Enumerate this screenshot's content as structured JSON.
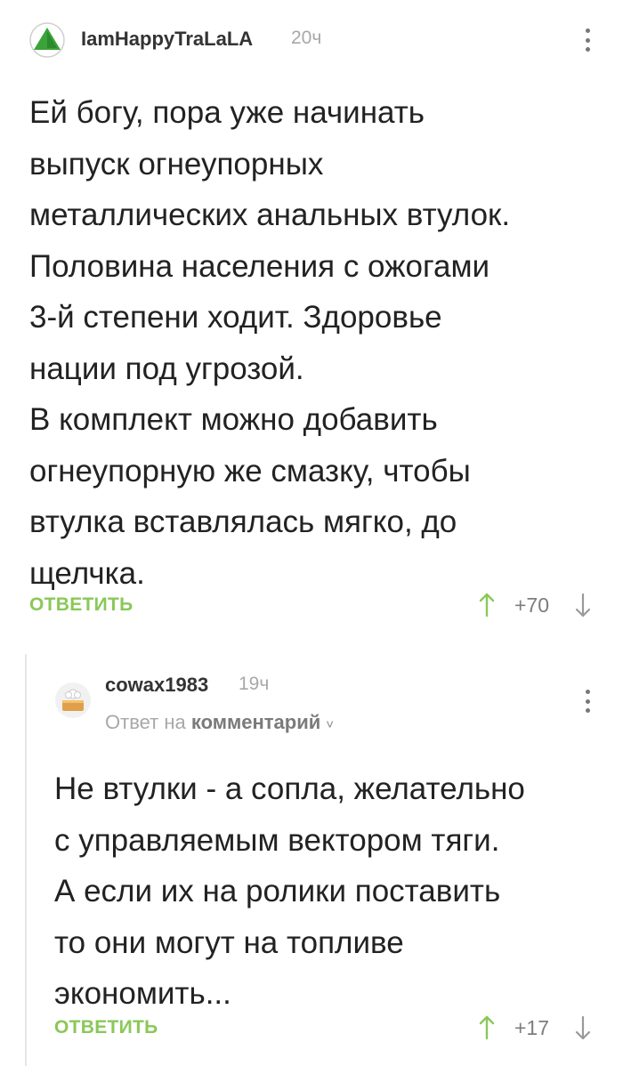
{
  "comments": [
    {
      "author": "IamHappyTraLaLA",
      "time": "20ч",
      "avatar_icon": "green-triangle-avatar-icon",
      "text_lines": [
        "Ей богу, пора уже начинать",
        "выпуск огнеупорных",
        "металлических анальных втулок.",
        "Половина населения с ожогами",
        "3-й степени ходит. Здоровье",
        "нации под угрозой.",
        "В комплект можно добавить",
        "огнеупорную же смазку, чтобы",
        "втулка вставлялась мягко, до",
        "щелчка."
      ],
      "reply_label": "ОТВЕТИТЬ",
      "rating": "+70"
    },
    {
      "author": "cowax1983",
      "time": "19ч",
      "avatar_icon": "cake-avatar-icon",
      "reply_prefix": "Ответ на",
      "reply_target": "комментарий",
      "text_lines": [
        "Не втулки - а сопла, желательно",
        "с управляемым вектором тяги.",
        "А если их на ролики поставить",
        "то они могут на топливе",
        "экономить..."
      ],
      "reply_label": "ОТВЕТИТЬ",
      "rating": "+17"
    }
  ],
  "colors": {
    "accent_green": "#8ac858",
    "muted_gray": "#a8a8a8",
    "text": "#222222"
  }
}
